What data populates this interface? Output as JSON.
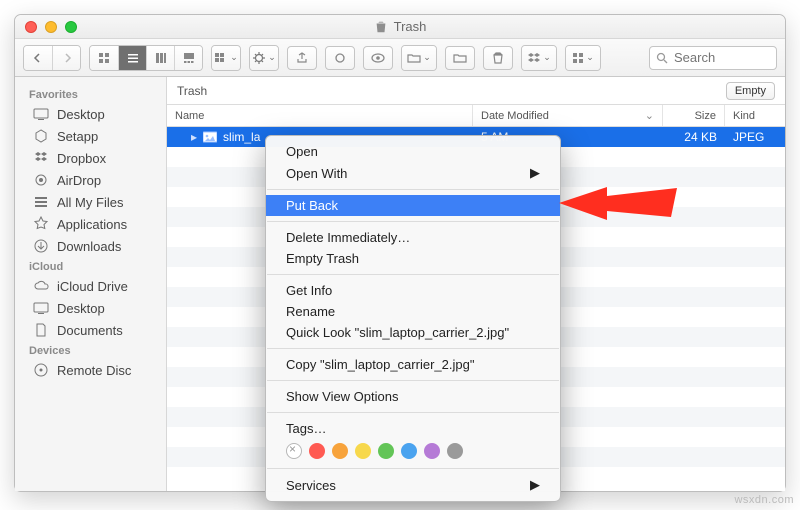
{
  "window": {
    "title": "Trash"
  },
  "toolbar": {
    "search_placeholder": "Search"
  },
  "sidebar": {
    "sections": [
      {
        "label": "Favorites",
        "items": [
          "Desktop",
          "Setapp",
          "Dropbox",
          "AirDrop",
          "All My Files",
          "Applications",
          "Downloads"
        ]
      },
      {
        "label": "iCloud",
        "items": [
          "iCloud Drive",
          "Desktop",
          "Documents"
        ]
      },
      {
        "label": "Devices",
        "items": [
          "Remote Disc"
        ]
      }
    ]
  },
  "pathbar": {
    "location": "Trash",
    "empty_label": "Empty"
  },
  "columns": {
    "name": "Name",
    "date": "Date Modified",
    "size": "Size",
    "kind": "Kind"
  },
  "rows": [
    {
      "name": "slim_la",
      "date": "5 AM",
      "size": "24 KB",
      "kind": "JPEG",
      "selected": true
    }
  ],
  "context_menu": {
    "open": "Open",
    "open_with": "Open With",
    "put_back": "Put Back",
    "delete_immediately": "Delete Immediately…",
    "empty_trash": "Empty Trash",
    "get_info": "Get Info",
    "rename": "Rename",
    "quick_look": "Quick Look \"slim_laptop_carrier_2.jpg\"",
    "copy": "Copy \"slim_laptop_carrier_2.jpg\"",
    "show_view_options": "Show View Options",
    "tags": "Tags…",
    "services": "Services",
    "tag_colors": [
      "#ff5a52",
      "#f7a33c",
      "#f7d84c",
      "#63c557",
      "#4aa3ef",
      "#b57ad6",
      "#9a9a9a"
    ]
  },
  "watermark": "wsxdn.com"
}
